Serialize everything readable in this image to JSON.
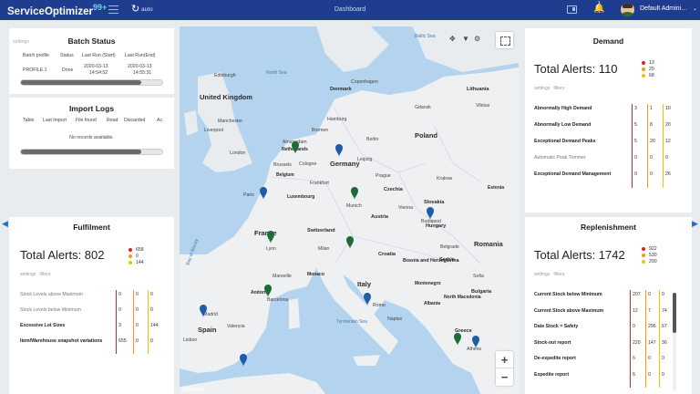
{
  "header": {
    "logo_part1": "Service",
    "logo_part2": "Optimizer",
    "logo_part3": "99+",
    "refresh_icon": "refresh-icon",
    "refresh_glyph": "↻",
    "auto_label": "auto",
    "title": "Dashboard",
    "notification_count": "1",
    "bell_glyph": "🔔",
    "user_name": "Default Admini…",
    "caret_glyph": "⌄"
  },
  "colors": {
    "header_bg": "#1e3d8f",
    "red": "#e02020",
    "orange": "#f39c12",
    "yellow": "#e6c800",
    "green_marker": "#1d6b35",
    "blue_marker": "#1f5da8"
  },
  "batch_status": {
    "title": "Batch Status",
    "settings": "settings",
    "columns": [
      "Batch profile",
      "Status",
      "Last Run (Start)",
      "Last Run(End)"
    ],
    "rows": [
      {
        "profile": "PROFILE 1",
        "status": "Done",
        "start": "2020-03-13",
        "start_time": "14:54:52",
        "end": "2020-03-13",
        "end_time": "14:55:31"
      }
    ],
    "progress": 0.85
  },
  "import_logs": {
    "title": "Import Logs",
    "columns": [
      "Table",
      "Last Import",
      "File found",
      "Read",
      "Discarded",
      "Ac"
    ],
    "empty": "No records available.",
    "progress": 0.85
  },
  "fulfilment": {
    "title": "Fulfilment",
    "total_label": "Total Alerts: 802",
    "legend": [
      {
        "value": "658",
        "color": "#e02020"
      },
      {
        "value": "0",
        "color": "#f39c12"
      },
      {
        "value": "144",
        "color": "#e6c800"
      }
    ],
    "settings": "settings",
    "filters": "filters",
    "rows": [
      {
        "label": "Stock Levels above Maximum",
        "bold": false,
        "v": [
          "0",
          "0",
          "0"
        ]
      },
      {
        "label": "Stock Levels below Minimum",
        "bold": false,
        "v": [
          "0",
          "0",
          "0"
        ]
      },
      {
        "label": "Excessive Lot Sizes",
        "bold": true,
        "v": [
          "3",
          "0",
          "144"
        ]
      },
      {
        "label": "Item/Warehouse snapshot variations",
        "bold": true,
        "v": [
          "655",
          "0",
          "0"
        ]
      }
    ]
  },
  "demand": {
    "title": "Demand",
    "total_label": "Total Alerts: 110",
    "legend": [
      {
        "value": "13",
        "color": "#e02020"
      },
      {
        "value": "29",
        "color": "#f39c12"
      },
      {
        "value": "68",
        "color": "#e6c800"
      }
    ],
    "settings": "settings",
    "filters": "filters",
    "rows": [
      {
        "label": "Abnormally High Demand",
        "bold": true,
        "v": [
          "3",
          "1",
          "10"
        ]
      },
      {
        "label": "Abnormally Low Demand",
        "bold": true,
        "v": [
          "5",
          "8",
          "20"
        ]
      },
      {
        "label": "Exceptional Demand Peaks",
        "bold": true,
        "v": [
          "5",
          "20",
          "12"
        ]
      },
      {
        "label": "Automatic Peak Trimmer",
        "bold": false,
        "v": [
          "0",
          "0",
          "0"
        ]
      },
      {
        "label": "Exceptional Demand Management",
        "bold": true,
        "v": [
          "0",
          "0",
          "26"
        ]
      }
    ]
  },
  "replenishment": {
    "title": "Replenishment",
    "total_label": "Total Alerts: 1742",
    "legend": [
      {
        "value": "922",
        "color": "#e02020"
      },
      {
        "value": "530",
        "color": "#f39c12"
      },
      {
        "value": "290",
        "color": "#e6c800"
      }
    ],
    "settings": "settings",
    "filters": "filters",
    "rows": [
      {
        "label": "Current Stock below Minimum",
        "bold": true,
        "v": [
          "207",
          "0",
          "0"
        ]
      },
      {
        "label": "Current Stock above Maximum",
        "bold": true,
        "v": [
          "12",
          "7",
          "74"
        ]
      },
      {
        "label": "Date Stock = Safety",
        "bold": true,
        "v": [
          "0",
          "296",
          "67"
        ]
      },
      {
        "label": "Stock-out report",
        "bold": true,
        "v": [
          "220",
          "147",
          "36"
        ]
      },
      {
        "label": "De-expedite report",
        "bold": true,
        "v": [
          "6",
          "0",
          "0"
        ]
      },
      {
        "label": "Expedite report",
        "bold": true,
        "v": [
          "6",
          "0",
          "0"
        ]
      }
    ]
  },
  "map": {
    "seas": [
      "Baltic Sea",
      "North Sea",
      "Bay of Biscay",
      "Tyrrhenian Sea"
    ],
    "countries": [
      "United Kingdom",
      "Denmark",
      "Lithuania",
      "Poland",
      "Germany",
      "France",
      "Czechia",
      "Slovakia",
      "Hungary",
      "Switzerland",
      "Italy",
      "Spain",
      "Romania",
      "Croatia",
      "Bosnia and Herzegovina",
      "Serbia",
      "Bulgaria",
      "Greece",
      "Monaco",
      "Andorra",
      "Montenegro",
      "Albania",
      "North Macedonia",
      "Belgium",
      "Luxembourg",
      "Netherlands",
      "Austria",
      "Estonia"
    ],
    "cities": [
      "Edinburgh",
      "Copenhagen",
      "Manchester",
      "Liverpool",
      "London",
      "Hamburg",
      "Amsterdam",
      "Bremen",
      "Berlin",
      "Brussels",
      "Cologne",
      "Leipzig",
      "Prague",
      "Paris",
      "Frankfurt",
      "Munich",
      "Vienna",
      "Milan",
      "Budapest",
      "Belgrade",
      "Barcelona",
      "Rome",
      "Madrid",
      "Lisbon",
      "Valencia",
      "Naples",
      "Sofia",
      "Athens",
      "Gdansk",
      "Vilnius",
      "Krakow",
      "Lyon",
      "Marseille",
      "Valencia"
    ],
    "markers_green": 6,
    "markers_blue": 6,
    "google": "Google"
  },
  "map_icons": {
    "move": "move-icon",
    "filter": "filter-icon",
    "gear": "gear-icon",
    "fullscreen": "fullscreen-icon",
    "zoom_in": "+",
    "zoom_out": "−"
  },
  "nav": {
    "left": "◀",
    "right": "▶"
  }
}
